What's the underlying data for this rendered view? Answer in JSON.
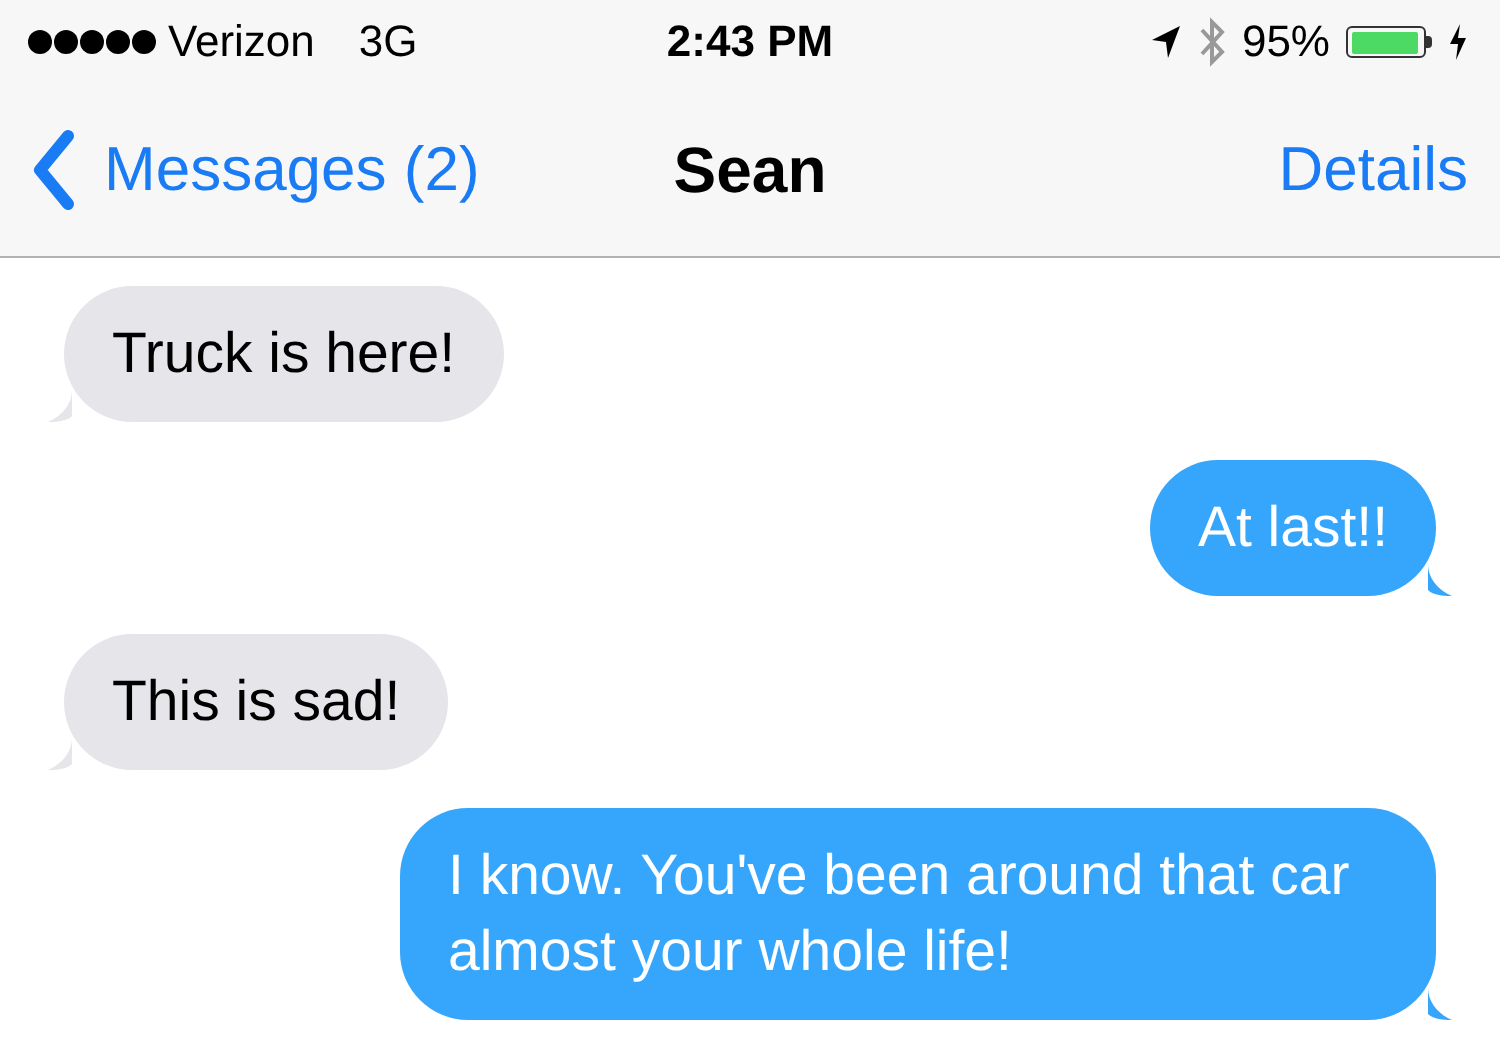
{
  "status_bar": {
    "carrier": "Verizon",
    "network": "3G",
    "time": "2:43 PM",
    "battery_text": "95%",
    "battery": {
      "level": 0.95
    }
  },
  "nav_bar": {
    "back": "Messages (2)",
    "title": "Sean",
    "action": "Details"
  },
  "messages": [
    {
      "kind": "received",
      "text": "Truck is here!"
    },
    {
      "kind": "sent",
      "text": "At last!!"
    },
    {
      "kind": "received",
      "text": "This is sad!"
    },
    {
      "kind": "sent",
      "text": "I know. You've been around that car almost your whole life!"
    }
  ]
}
